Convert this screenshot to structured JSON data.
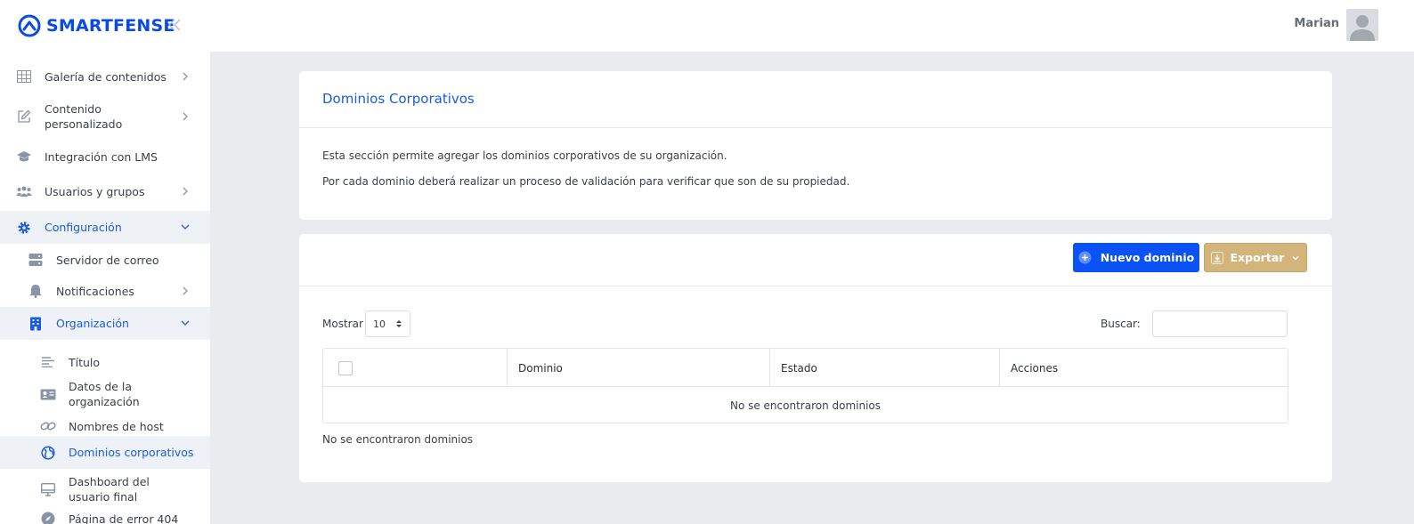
{
  "app": {
    "brand": "SMARTFENSE"
  },
  "user": {
    "name": "Marian"
  },
  "sidebar": {
    "items": [
      {
        "label": "Galería de contenidos",
        "icon": "grid-icon"
      },
      {
        "label": "Contenido personalizado",
        "icon": "edit-icon"
      },
      {
        "label": "Integración con LMS",
        "icon": "graduation-cap-icon"
      },
      {
        "label": "Usuarios y grupos",
        "icon": "users-icon"
      },
      {
        "label": "Configuración",
        "icon": "gear-icon"
      },
      {
        "label": "Servidor de correo",
        "icon": "server-icon"
      },
      {
        "label": "Notificaciones",
        "icon": "bell-icon"
      },
      {
        "label": "Organización",
        "icon": "building-icon"
      },
      {
        "label": "Título",
        "icon": "align-left-icon"
      },
      {
        "label": "Datos de la organización",
        "icon": "id-card-icon"
      },
      {
        "label": "Nombres de host",
        "icon": "link-icon"
      },
      {
        "label": "Dominios corporativos",
        "icon": "globe-icon"
      },
      {
        "label": "Dashboard del usuario final",
        "icon": "monitor-icon"
      },
      {
        "label": "Página de error 404",
        "icon": "compass-icon"
      }
    ]
  },
  "intro": {
    "title": "Dominios Corporativos",
    "line1": "Esta sección permite agregar los dominios corporativos de su organización.",
    "line2": "Por cada dominio deberá realizar un proceso de validación para verificar que son de su propiedad."
  },
  "toolbar": {
    "new_label": "Nuevo dominio",
    "export_label": "Exportar"
  },
  "table_controls": {
    "show_label": "Mostrar",
    "page_size": "10",
    "search_label": "Buscar:",
    "search_value": ""
  },
  "table": {
    "columns": [
      "Dominio",
      "Estado",
      "Acciones"
    ],
    "empty_message": "No se encontraron dominios"
  },
  "footer": {
    "info": "No se encontraron dominios"
  },
  "colors": {
    "accent": "#0a52f5",
    "export": "#d3b57c",
    "link": "#1a5cde"
  }
}
